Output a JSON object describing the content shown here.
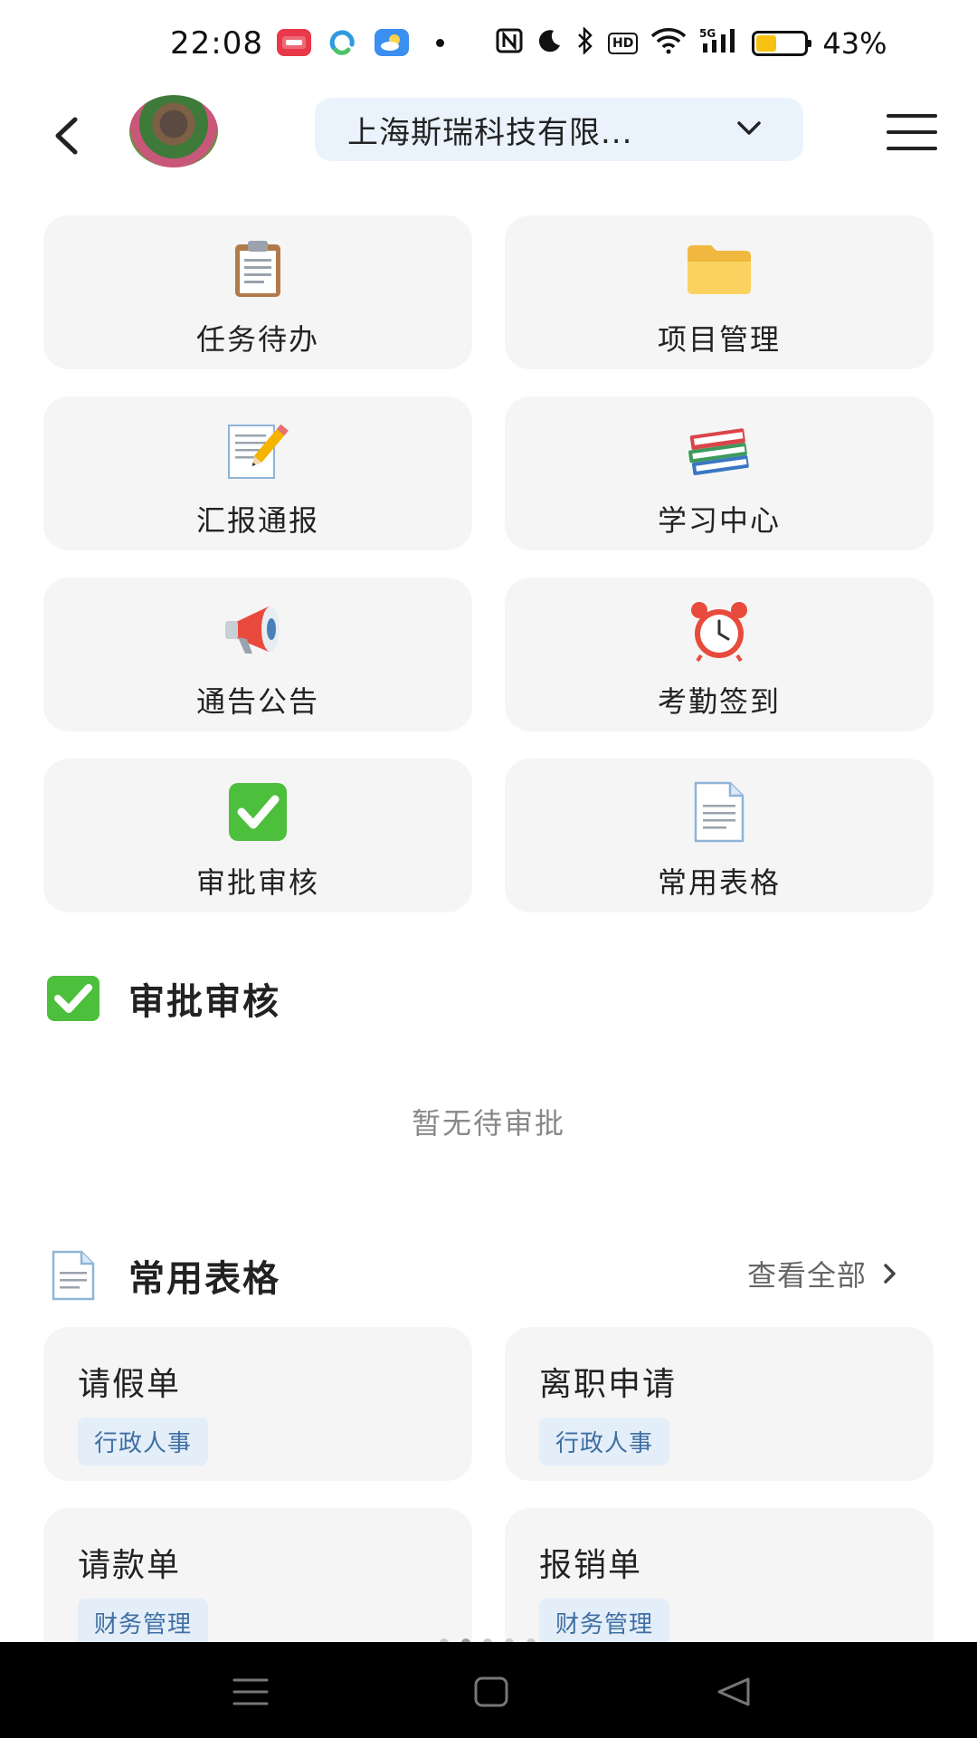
{
  "status_bar": {
    "time": "22:08",
    "battery_percent": "43%",
    "battery_level": 0.43,
    "icons": [
      "app-icon",
      "app-icon",
      "weather-icon",
      "dot-icon",
      "nfc-icon",
      "moon-icon",
      "bluetooth-icon",
      "hd-icon",
      "wifi-icon",
      "signal-5g-icon",
      "battery-icon"
    ]
  },
  "header": {
    "company_name": "上海斯瑞科技有限...",
    "back_icon": "chevron-left-icon",
    "menu_icon": "hamburger-menu-icon"
  },
  "modules": [
    {
      "label": "任务待办",
      "icon": "clipboard-icon"
    },
    {
      "label": "项目管理",
      "icon": "folder-icon"
    },
    {
      "label": "汇报通报",
      "icon": "memo-icon"
    },
    {
      "label": "学习中心",
      "icon": "books-icon"
    },
    {
      "label": "通告公告",
      "icon": "megaphone-icon"
    },
    {
      "label": "考勤签到",
      "icon": "alarm-clock-icon"
    },
    {
      "label": "审批审核",
      "icon": "check-mark-icon"
    },
    {
      "label": "常用表格",
      "icon": "document-icon"
    }
  ],
  "approval_section": {
    "title": "审批审核",
    "empty_text": "暂无待审批"
  },
  "forms_section": {
    "title": "常用表格",
    "view_all": "查看全部",
    "forms": [
      {
        "name": "请假单",
        "tag": "行政人事"
      },
      {
        "name": "离职申请",
        "tag": "行政人事"
      },
      {
        "name": "请款单",
        "tag": "财务管理"
      },
      {
        "name": "报销单",
        "tag": "财务管理"
      }
    ]
  },
  "colors": {
    "card_bg": "#f5f5f5",
    "select_bg": "#eaf3fc",
    "tag_bg": "#e4eef8",
    "tag_text": "#3f6fa3",
    "battery_fill": "#f5c211"
  }
}
